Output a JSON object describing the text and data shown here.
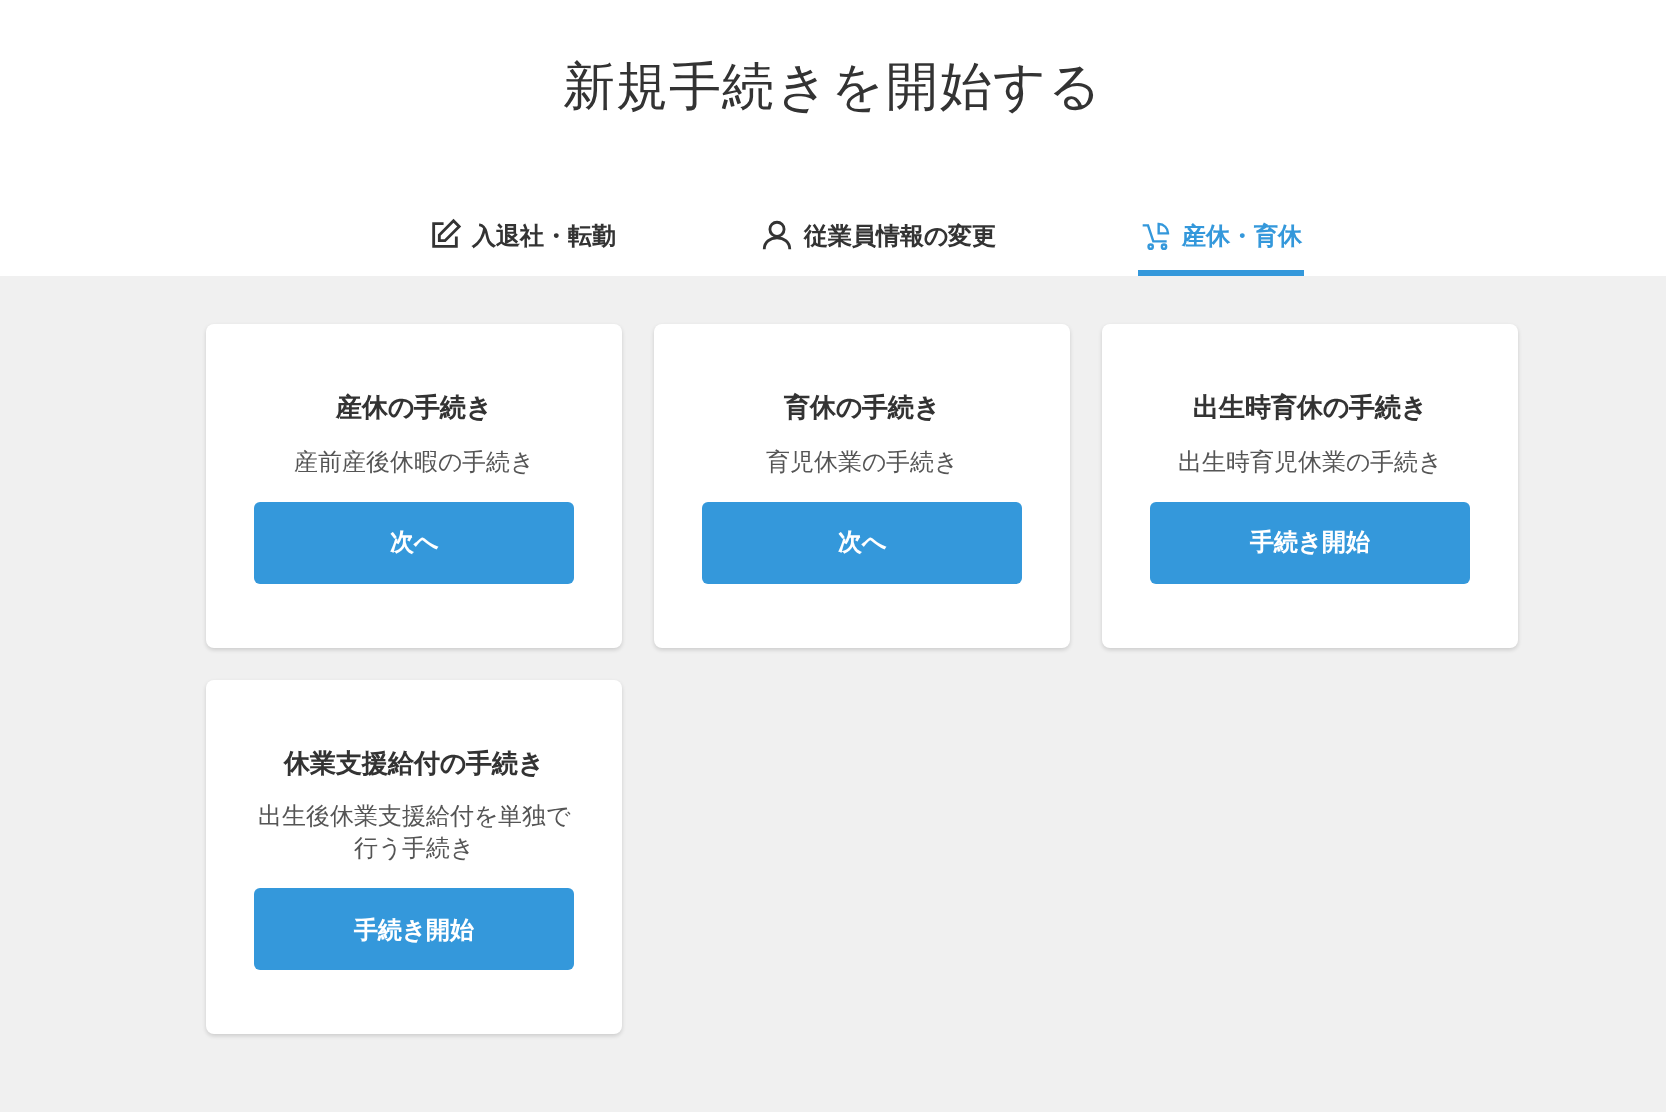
{
  "title": "新規手続きを開始する",
  "tabs": [
    {
      "label": "入退社・転勤",
      "kind": "edit",
      "selected": false
    },
    {
      "label": "従業員情報の変更",
      "kind": "person",
      "selected": false
    },
    {
      "label": "産休・育休",
      "kind": "stroller",
      "selected": true
    }
  ],
  "cards": [
    {
      "title": "産休の手続き",
      "description": "産前産後休暇の手続き",
      "button": "次へ"
    },
    {
      "title": "育休の手続き",
      "description": "育児休業の手続き",
      "button": "次へ"
    },
    {
      "title": "出生時育休の手続き",
      "description": "出生時育児休業の手続き",
      "button": "手続き開始"
    },
    {
      "title": "休業支援給付の手続き",
      "description": "出生後休業支援給付を単独で行う手続き",
      "button": "手続き開始"
    }
  ]
}
